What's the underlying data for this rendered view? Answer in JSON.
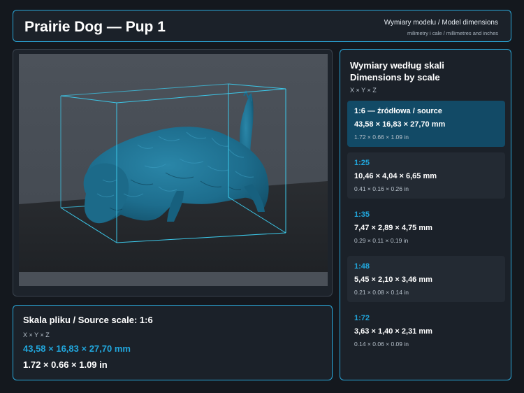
{
  "header": {
    "title": "Prairie Dog — Pup 1",
    "subtitle": "Wymiary modelu / Model dimensions",
    "units_note": "milimetry i cale / millimetres and inches"
  },
  "viewport": {
    "model_color": "#1f6f8f",
    "box_color": "#3cc7e8"
  },
  "source": {
    "label": "Skala pliku / Source scale: 1:6",
    "axes": "X × Y × Z",
    "mm": "43,58 × 16,83 × 27,70 mm",
    "inch": "1.72 × 0.66 × 1.09 in"
  },
  "scales": {
    "heading_line1": "Wymiary według skali",
    "heading_line2": "Dimensions by scale",
    "axes": "X × Y × Z",
    "items": [
      {
        "ratio": "1:6  —  źródłowa / source",
        "mm": "43,58 × 16,83 × 27,70 mm",
        "inch": "1.72 × 0.66 × 1.09 in",
        "active": true
      },
      {
        "ratio": "1:25",
        "mm": "10,46 × 4,04 × 6,65 mm",
        "inch": "0.41 × 0.16 × 0.26 in"
      },
      {
        "ratio": "1:35",
        "mm": "7,47 × 2,89 × 4,75 mm",
        "inch": "0.29 × 0.11 × 0.19 in"
      },
      {
        "ratio": "1:48",
        "mm": "5,45 × 2,10 × 3,46 mm",
        "inch": "0.21 × 0.08 × 0.14 in"
      },
      {
        "ratio": "1:72",
        "mm": "3,63 × 1,40 × 2,31 mm",
        "inch": "0.14 × 0.06 × 0.09 in"
      }
    ]
  },
  "colors": {
    "accent": "#21a6dc",
    "active_row": "#124a66",
    "panel": "#1b2129",
    "background": "#14181e"
  }
}
